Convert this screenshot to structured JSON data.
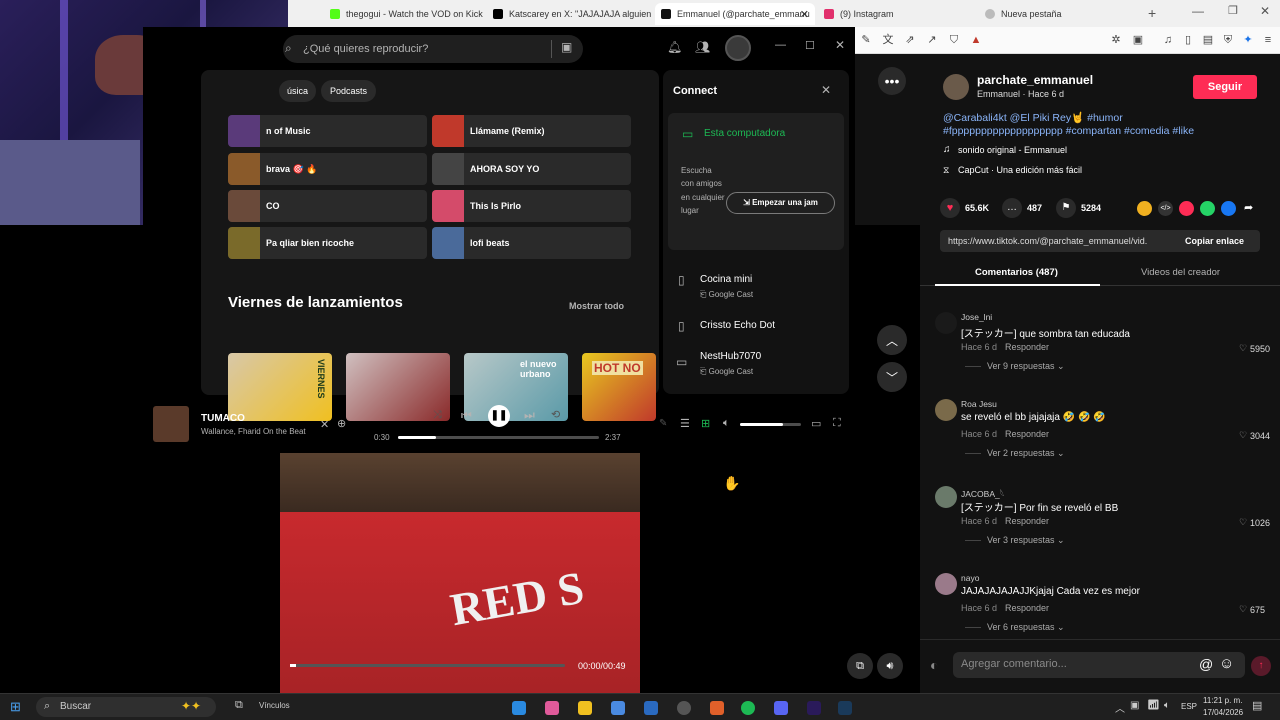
{
  "browser": {
    "tabs": [
      {
        "label": "thegogui - Watch the VOD on Kick",
        "color": "#53fc18"
      },
      {
        "label": "Katscarey en X: \"JAJAJAJA alguien e",
        "color": "#000000"
      },
      {
        "label": "Emmanuel (@parchate_emmanu",
        "color": "#111111"
      },
      {
        "label": "(9) Instagram",
        "color": "#e1306c"
      },
      {
        "label": "Nueva pestaña",
        "color": "#888888"
      }
    ],
    "new_tab_glyph": "+"
  },
  "spotify": {
    "search_placeholder": "¿Qué quieres reproducir?",
    "filters": [
      "úsica",
      "Podcasts"
    ],
    "quick_cards": [
      {
        "label": "n of Music",
        "color": "#5a3a7a"
      },
      {
        "label": "Llámame (Remix)",
        "color": "#c0392b"
      },
      {
        "label": "brava 🎯 🔥",
        "color": "#8a5a2a"
      },
      {
        "label": "AHORA SOY YO",
        "color": "#444444"
      },
      {
        "label": "CO",
        "color": "#6a4a3a"
      },
      {
        "label": "This Is Pirlo",
        "color": "#d44b6a"
      },
      {
        "label": "Pa qliar bien ricoche",
        "color": "#7a6a2a"
      },
      {
        "label": "lofi beats",
        "color": "#4a6a9a"
      }
    ],
    "section_title": "Viernes de lanzamientos",
    "show_all": "Mostrar todo",
    "cover_texts": [
      "VIERNES",
      "el nuevo urbano",
      "HOT NO"
    ],
    "connect": {
      "title": "Connect",
      "current_device": "Esta computadora",
      "jam_text": "Escucha con amigos en cualquier lugar",
      "jam_button": "Empezar una jam",
      "devices": [
        {
          "name": "Cocina mini",
          "sub": "Google Cast"
        },
        {
          "name": "Crissto Echo Dot",
          "sub": ""
        },
        {
          "name": "NestHub7070",
          "sub": "Google Cast"
        }
      ]
    },
    "player": {
      "track": "TUMACO",
      "artist": "Wallance, Fharid On the Beat",
      "elapsed": "0:30",
      "duration": "2:37",
      "progress": 0.19,
      "volume": 0.7
    }
  },
  "video": {
    "time": "00:00/00:49",
    "progress": 0.0
  },
  "tiktok": {
    "username": "parchate_emmanuel",
    "subtitle": "Emmanuel · Hace 6 d",
    "follow": "Seguir",
    "caption_line1": "@Carabali4kt @El Piki Rey🤘 #humor",
    "caption_line2": "#fppppppppppppppppppp #compartan #comedia #like",
    "sound": "sonido original - Emmanuel",
    "capcut": "CapCut · Una edición más fácil",
    "likes": "65.6K",
    "comments_count": "487",
    "saves": "5284",
    "link": "https://www.tiktok.com/@parchate_emmanuel/vid...",
    "copy_link": "Copiar enlace",
    "tab_comments": "Comentarios (487)",
    "tab_videos": "Videos del creador",
    "comments": [
      {
        "user": "Jose_lni",
        "text": "[ステッカー] que sombra tan educada",
        "time": "Hace 6 d",
        "reply": "Responder",
        "likes": "5950",
        "replies": "Ver 9 respuestas",
        "color": "#1a1a1a"
      },
      {
        "user": "Roa      Jesu",
        "text": "se reveló el bb jajajaja 🤣 🤣 🤣",
        "time": "Hace 6 d",
        "reply": "Responder",
        "likes": "3044",
        "replies": "Ver 2 respuestas",
        "color": "#7a6a4a"
      },
      {
        "user": "JACOBA_𓆩",
        "text": "[ステッカー] Por fin se reveló el BB",
        "time": "Hace 6 d",
        "reply": "Responder",
        "likes": "1026",
        "replies": "Ver 3 respuestas",
        "color": "#6a7a6a"
      },
      {
        "user": "nayo",
        "text": "JAJAJAJAJAJJKjajaj Cada vez es mejor",
        "time": "Hace 6 d",
        "reply": "Responder",
        "likes": "675",
        "replies": "Ver 6 respuestas",
        "color": "#9a7a8a"
      }
    ],
    "comment_placeholder": "Agregar comentario...",
    "at_glyph": "@",
    "emoji_glyph": "☺"
  },
  "taskbar": {
    "search": "Buscar",
    "links": "Vínculos",
    "lang": "ESP",
    "time": "11:21 p. m.",
    "date": "17/04/2026"
  }
}
